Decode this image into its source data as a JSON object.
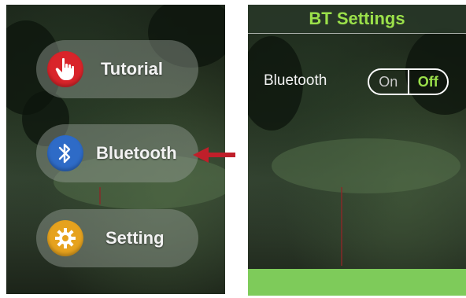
{
  "menu": {
    "items": [
      {
        "label": "Tutorial",
        "icon": "hand-pointer-icon",
        "color": "#d9242a"
      },
      {
        "label": "Bluetooth",
        "icon": "bluetooth-icon",
        "color": "#2e6bc7"
      },
      {
        "label": "Setting",
        "icon": "gear-icon",
        "color": "#e6a21e"
      }
    ]
  },
  "bt_settings": {
    "title": "BT Settings",
    "bluetooth_label": "Bluetooth",
    "toggle_on": "On",
    "toggle_off": "Off",
    "selected": "Off"
  },
  "colors": {
    "accent_green": "#9be04a",
    "arrow_red": "#c01f2a",
    "bottom_bar": "#7ecb5a"
  }
}
